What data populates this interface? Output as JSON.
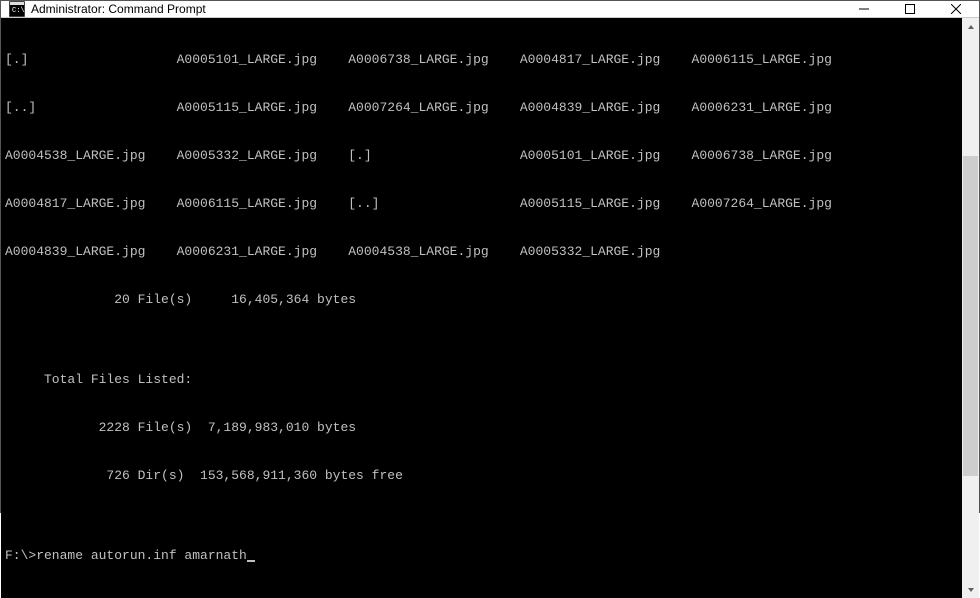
{
  "window": {
    "title": "Administrator: Command Prompt"
  },
  "terminal": {
    "lines": [
      "[.]                   A0005101_LARGE.jpg    A0006738_LARGE.jpg    A0004817_LARGE.jpg    A0006115_LARGE.jpg",
      "[..]                  A0005115_LARGE.jpg    A0007264_LARGE.jpg    A0004839_LARGE.jpg    A0006231_LARGE.jpg",
      "A0004538_LARGE.jpg    A0005332_LARGE.jpg    [.]                   A0005101_LARGE.jpg    A0006738_LARGE.jpg",
      "A0004817_LARGE.jpg    A0006115_LARGE.jpg    [..]                  A0005115_LARGE.jpg    A0007264_LARGE.jpg",
      "A0004839_LARGE.jpg    A0006231_LARGE.jpg    A0004538_LARGE.jpg    A0005332_LARGE.jpg",
      "              20 File(s)     16,405,364 bytes",
      "",
      "     Total Files Listed:",
      "            2228 File(s)  7,189,983,010 bytes",
      "             726 Dir(s)  153,568,911,360 bytes free",
      "",
      "F:\\>rename autorun.inf amarnath"
    ]
  }
}
